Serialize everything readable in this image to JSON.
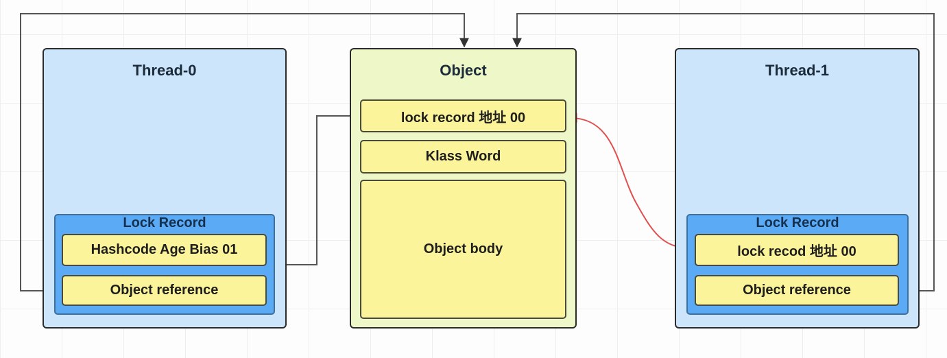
{
  "thread0": {
    "title": "Thread-0",
    "lock_record": {
      "title": "Lock Record",
      "fields": [
        "Hashcode Age Bias 01",
        "Object reference"
      ]
    }
  },
  "object": {
    "title": "Object",
    "fields": [
      "lock record 地址 00",
      "Klass Word",
      "Object body"
    ]
  },
  "thread1": {
    "title": "Thread-1",
    "lock_record": {
      "title": "Lock Record",
      "fields": [
        "lock recod 地址 00",
        "Object reference"
      ]
    }
  },
  "colors": {
    "thread_bg": "#cce5fb",
    "object_bg": "#eef7c8",
    "lock_record_bg": "#5aaaf5",
    "field_bg": "#fbf49a",
    "connector": "#444444",
    "cas_arrow": "#e02020"
  }
}
